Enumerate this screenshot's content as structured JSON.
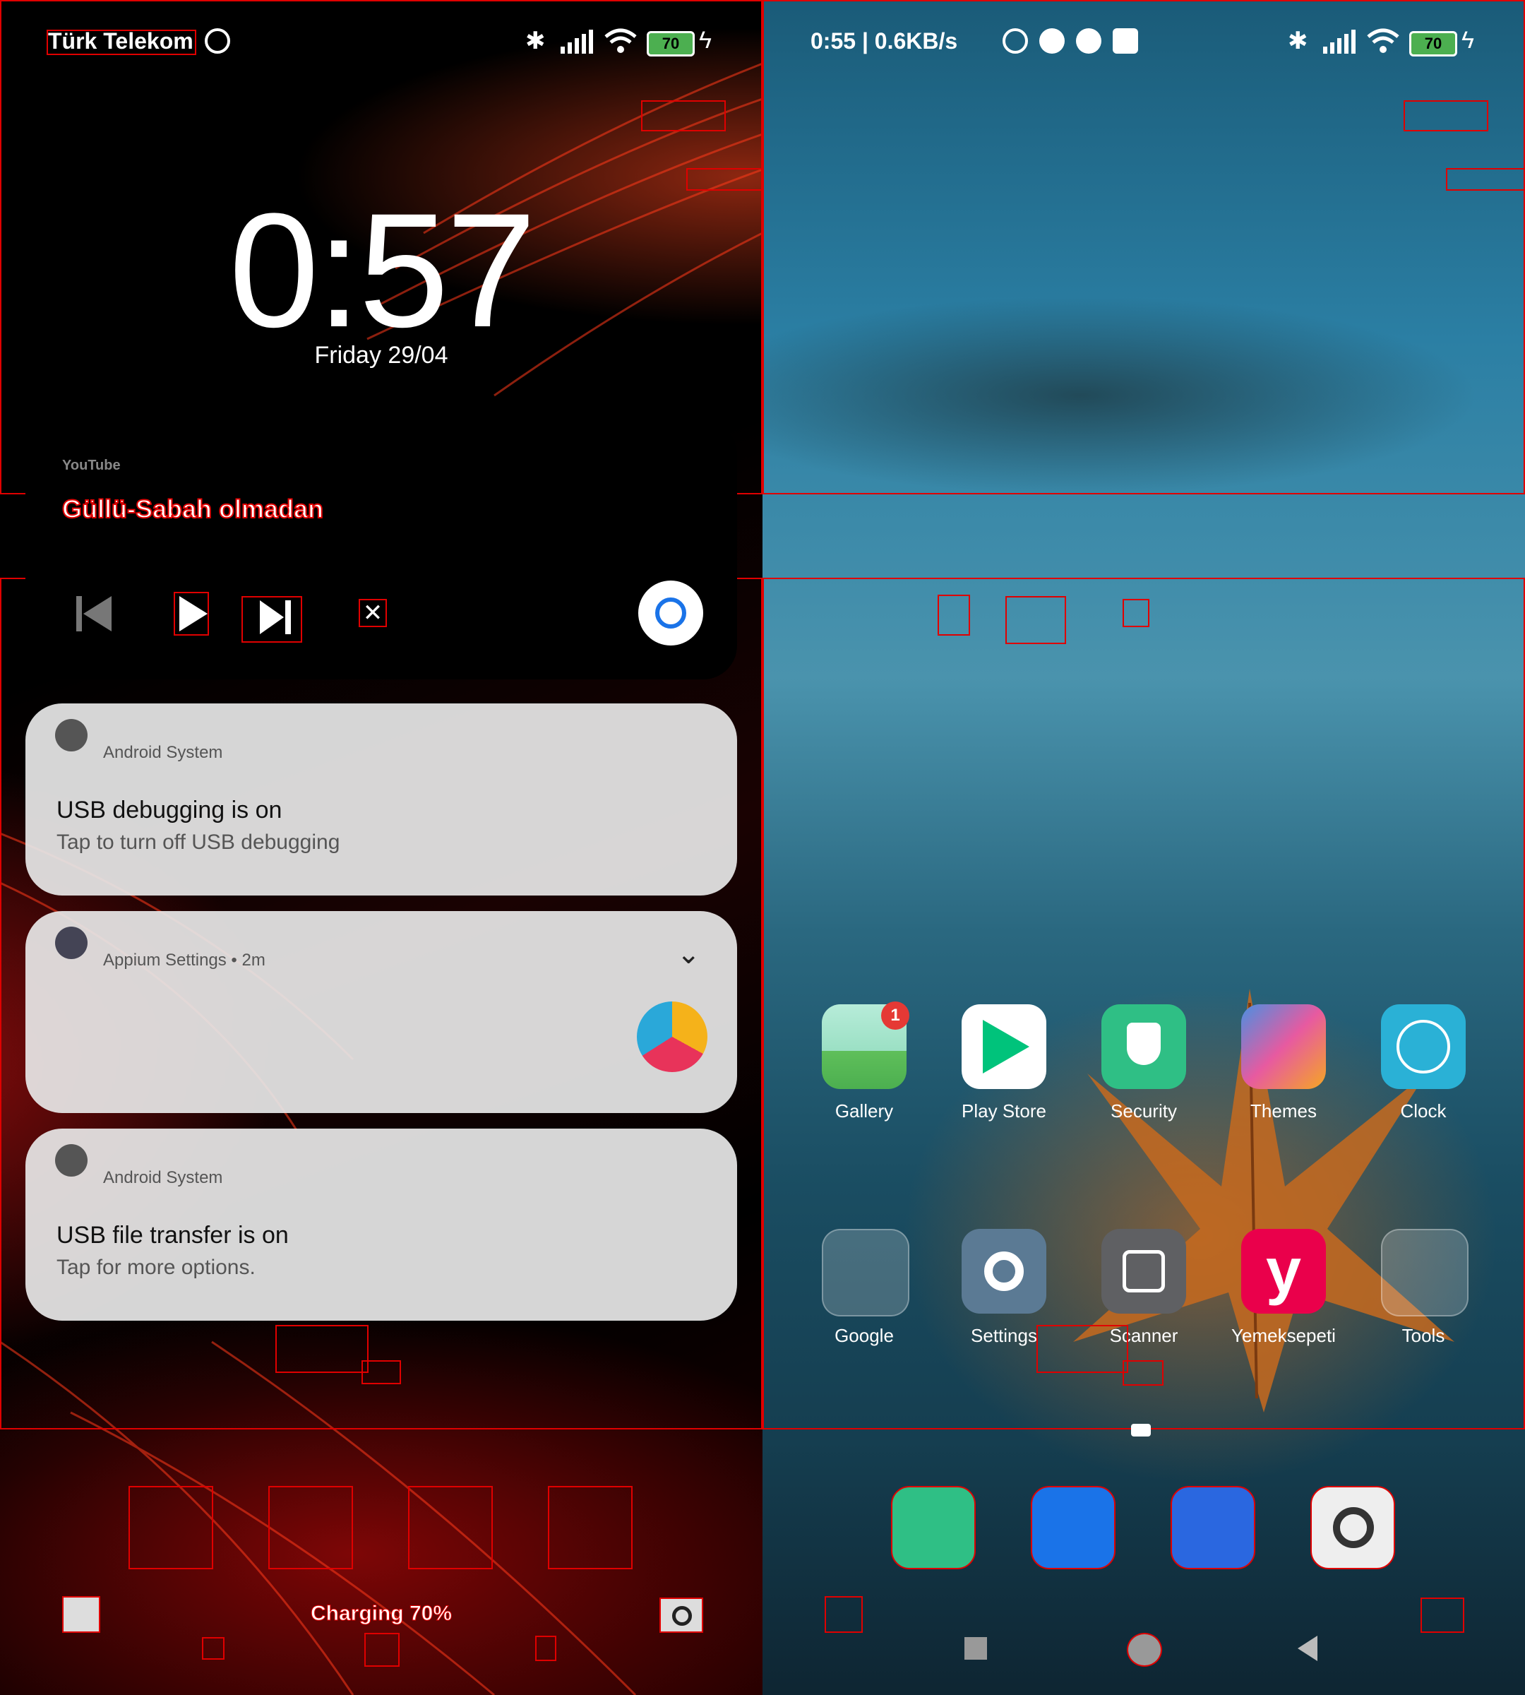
{
  "left_screen": {
    "status": {
      "carrier": "Türk Telekom",
      "battery": "70"
    },
    "clock": "0:57",
    "date": "Friday 29/04",
    "media": {
      "app": "YouTube",
      "title": "Güllü-Sabah olmadan"
    },
    "notifications": [
      {
        "app": "Android System",
        "title": "USB debugging is on",
        "text": "Tap to turn off USB debugging"
      },
      {
        "app": "Appium Settings",
        "time": "2m"
      },
      {
        "app": "Android System",
        "title": "USB file transfer is on",
        "text": "Tap for more options."
      }
    ],
    "charging": "Charging 70%"
  },
  "right_screen": {
    "status": {
      "time_speed": "0:55 | 0.6KB/s",
      "battery": "70"
    },
    "apps_row1": [
      "Gallery",
      "Play Store",
      "Security",
      "Themes",
      "Clock"
    ],
    "apps_row2": [
      "Google",
      "Settings",
      "Scanner",
      "Yemeksepeti",
      "Tools"
    ],
    "gallery_badge": "1"
  },
  "colors": {
    "accent_red": "#e00000",
    "battery_green": "#4caf50"
  }
}
